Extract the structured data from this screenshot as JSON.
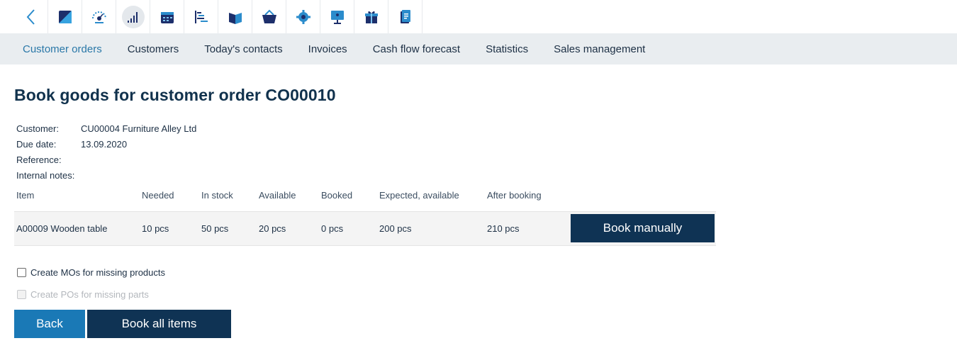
{
  "toolbar": {
    "icons": [
      "back-icon",
      "edit-icon",
      "dashboard-icon",
      "signal-bars-icon",
      "calendar-icon",
      "gantt-icon",
      "box-icon",
      "basket-icon",
      "gear-icon",
      "presentation-icon",
      "gift-icon",
      "document-icon"
    ],
    "active_icon": "signal-bars-icon"
  },
  "subnav": {
    "tabs": [
      "Customer orders",
      "Customers",
      "Today's contacts",
      "Invoices",
      "Cash flow forecast",
      "Statistics",
      "Sales management"
    ],
    "active_tab": "Customer orders"
  },
  "page": {
    "title": "Book goods for customer order CO00010"
  },
  "info": {
    "customer_label": "Customer:",
    "customer_value": "CU00004 Furniture Alley Ltd",
    "due_label": "Due date:",
    "due_value": "13.09.2020",
    "reference_label": "Reference:",
    "reference_value": "",
    "notes_label": "Internal notes:",
    "notes_value": ""
  },
  "table": {
    "columns": [
      "Item",
      "Needed",
      "In stock",
      "Available",
      "Booked",
      "Expected, available",
      "After booking"
    ],
    "rows": [
      {
        "item": "A00009 Wooden table",
        "needed": "10 pcs",
        "in_stock": "50 pcs",
        "available": "20 pcs",
        "booked": "0 pcs",
        "expected_available": "200 pcs",
        "after_booking": "210 pcs",
        "action_label": "Book manually"
      }
    ]
  },
  "options": {
    "create_mos_label": "Create MOs for missing products",
    "create_mos_checked": false,
    "create_pos_label": "Create POs for missing parts",
    "create_pos_checked": false,
    "create_pos_disabled": true
  },
  "actions": {
    "back_label": "Back",
    "book_all_label": "Book all items"
  },
  "colors": {
    "accent": "#1a79b6",
    "dark_button": "#0f3354",
    "active_tab": "#2a78a8",
    "subnav_bg": "#e9edf0"
  }
}
